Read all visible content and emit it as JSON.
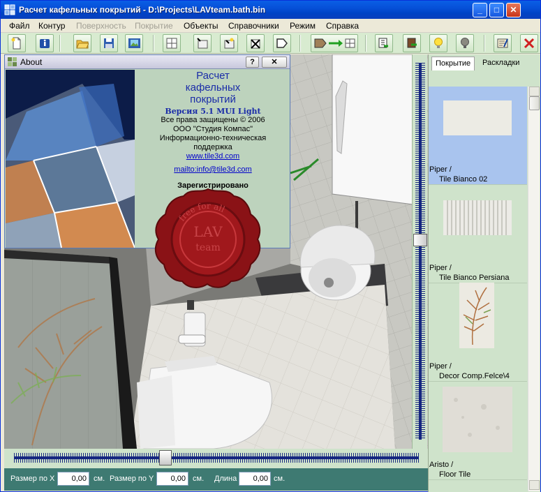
{
  "window": {
    "title": "Расчет кафельных покрытий - D:\\Projects\\LAVteam.bath.bin",
    "controls": {
      "minimize": "_",
      "maximize": "□",
      "close": "✕"
    }
  },
  "menu": {
    "items": [
      {
        "label": "Файл",
        "enabled": true
      },
      {
        "label": "Контур",
        "enabled": true
      },
      {
        "label": "Поверхность",
        "enabled": false
      },
      {
        "label": "Покрытие",
        "enabled": false
      },
      {
        "label": "Объекты",
        "enabled": true
      },
      {
        "label": "Справочники",
        "enabled": true
      },
      {
        "label": "Режим",
        "enabled": true
      },
      {
        "label": "Справка",
        "enabled": true
      }
    ]
  },
  "toolbar": {
    "buttons": [
      "new-document-icon",
      "info-icon",
      "open-folder-icon",
      "save-icon",
      "save-image-icon",
      "grid-icon",
      "add-rect-icon",
      "add-point-icon",
      "delete-contour-icon",
      "shape-icon",
      "shape-arrow-tile-icon",
      "import-icon",
      "export-icon",
      "lamp-on-icon",
      "lamp-off-icon",
      "calculate-icon",
      "close-x-icon"
    ]
  },
  "about": {
    "title": "About",
    "help_btn": "?",
    "close_btn": "✕",
    "product_line1": "Расчет",
    "product_line2": "кафельных",
    "product_line3": "покрытий",
    "version": "Версия 5.1 MUI Light",
    "copyright": "Все права защищены © 2006",
    "company": "ООО \"Студия Компас\"",
    "support1": "Информационно-техническая",
    "support2": "поддержка",
    "website": "www.tile3d.com",
    "email": "mailto:info@tile3d.com",
    "registered": "Зарегистрировано",
    "seal_text": "LAV team",
    "seal_ring": "free for all"
  },
  "rightpanel": {
    "tabs": [
      {
        "label": "Покрытие",
        "active": true
      },
      {
        "label": "Раскладки",
        "active": false
      }
    ],
    "tiles": [
      {
        "brand": "Piper /",
        "name": "Tile Bianco 02",
        "selected": true
      },
      {
        "brand": "Piper /",
        "name": "Tile Bianco Persiana",
        "selected": false
      },
      {
        "brand": "Piper /",
        "name": "Decor Comp.Felce\\4",
        "selected": false
      },
      {
        "brand": "Aristo /",
        "name": "Floor Tile",
        "selected": false
      }
    ]
  },
  "status": {
    "size_x_label": "Размер по X",
    "size_x_value": "0,00",
    "size_x_unit": "см.",
    "size_y_label": "Размер по Y",
    "size_y_value": "0,00",
    "size_y_unit": "см.",
    "length_label": "Длина",
    "length_value": "0,00",
    "length_unit": "см."
  },
  "sliders": {
    "horizontal_position": 0.37,
    "vertical_position": 0.47
  },
  "colors": {
    "titlebar": "#0650d8",
    "panel_green": "#cfe3cb",
    "status_teal": "#3e7a72",
    "selected_tile": "#a9c4ee",
    "seal_red": "#8a1216"
  }
}
